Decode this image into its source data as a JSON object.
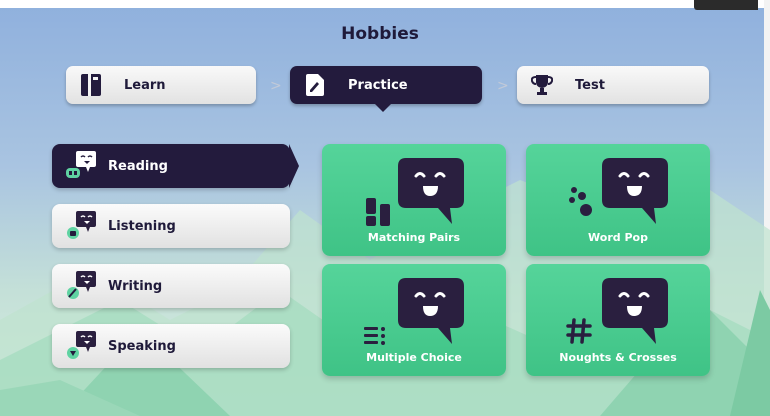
{
  "header": {
    "title": "Hobbies"
  },
  "steps": [
    {
      "label": "Learn",
      "icon": "book-icon",
      "active": false
    },
    {
      "label": "Practice",
      "icon": "pencil-note-icon",
      "active": true
    },
    {
      "label": "Test",
      "icon": "trophy-icon",
      "active": false
    }
  ],
  "skills": [
    {
      "label": "Reading",
      "icon": "reading-chat-icon",
      "active": true
    },
    {
      "label": "Listening",
      "icon": "listening-chat-icon",
      "active": false
    },
    {
      "label": "Writing",
      "icon": "writing-chat-icon",
      "active": false
    },
    {
      "label": "Speaking",
      "icon": "speaking-chat-icon",
      "active": false
    }
  ],
  "activities": [
    {
      "label": "Matching Pairs",
      "icon": "matching-pairs-icon"
    },
    {
      "label": "Word Pop",
      "icon": "word-pop-icon"
    },
    {
      "label": "Multiple Choice",
      "icon": "multiple-choice-icon"
    },
    {
      "label": "Noughts & Crosses",
      "icon": "noughts-crosses-icon"
    }
  ],
  "colors": {
    "dark": "#231b3d",
    "green": "#4bcb8f",
    "mascot": "#2a1f3f"
  }
}
